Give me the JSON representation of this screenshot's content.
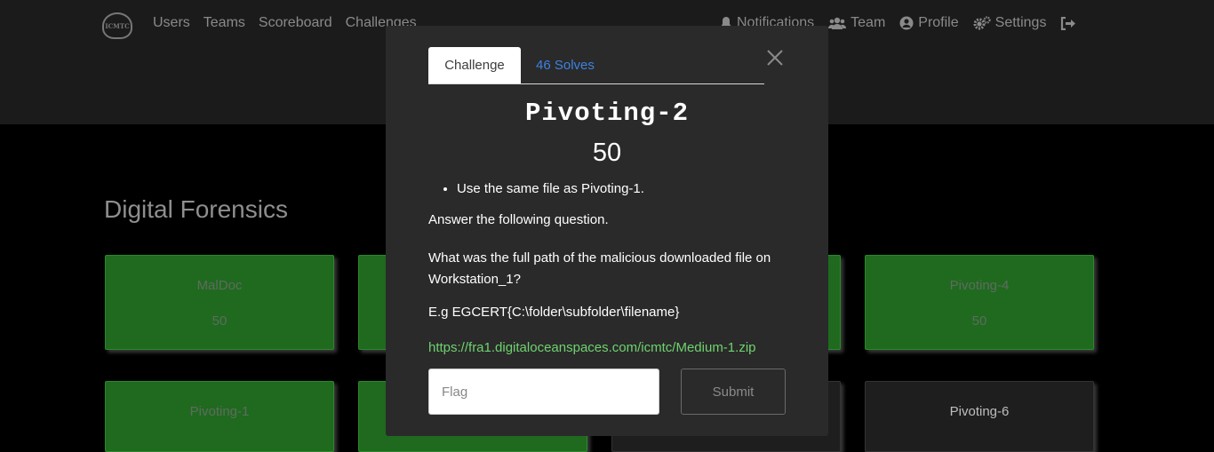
{
  "nav": {
    "logo_text": "ICMTC",
    "left": [
      "Users",
      "Teams",
      "Scoreboard",
      "Challenges"
    ],
    "right": [
      {
        "label": "Notifications",
        "icon": "bell-icon"
      },
      {
        "label": "Team",
        "icon": "users-icon"
      },
      {
        "label": "Profile",
        "icon": "user-circle-icon"
      },
      {
        "label": "Settings",
        "icon": "cogs-icon"
      }
    ],
    "logout_icon": "sign-out-icon"
  },
  "category": "Digital Forensics",
  "cards": [
    {
      "name": "MalDoc",
      "value": "50",
      "status": "solved"
    },
    {
      "name": "Pivoting-4",
      "value": "50",
      "status": "solved"
    },
    {
      "name": "Pivoting-1",
      "value": "",
      "status": "solved"
    },
    {
      "name": "Pivoting-6",
      "value": "",
      "status": "unsolved"
    }
  ],
  "modal": {
    "tab_challenge": "Challenge",
    "tab_solves": "46 Solves",
    "title": "Pivoting-2",
    "value": "50",
    "bullet": "Use the same file as Pivoting-1.",
    "para1": "Answer the following question.",
    "para2": "What was the full path of the malicious downloaded file on Workstation_1?",
    "para3": "E.g EGCERT{C:\\folder\\subfolder\\filename}",
    "link": "https://fra1.digitaloceanspaces.com/icmtc/Medium-1.zip",
    "flag_placeholder": "Flag",
    "submit_label": "Submit"
  },
  "colors": {
    "solved": "#1f6a1f",
    "link": "#6ed36e",
    "tab_link": "#3e82e0",
    "modal_bg": "#2a2a2a"
  }
}
